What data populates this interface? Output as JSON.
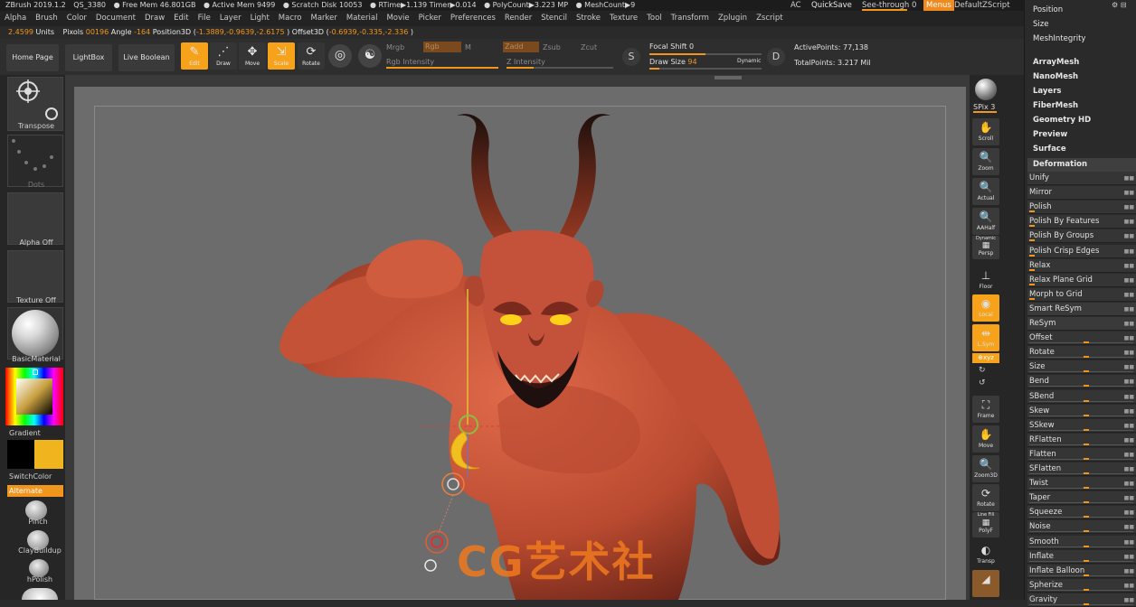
{
  "titlebar": {
    "app": "ZBrush 2019.1.2",
    "doc": "QS_3380",
    "free_mem": "● Free Mem 46.801GB",
    "active_mem": "● Active Mem 9499",
    "scratch": "● Scratch Disk 10053",
    "rtime": "● RTime▶1.139 Timer▶0.014",
    "polycount": "● PolyCount▶3.223 MP",
    "meshcount": "● MeshCount▶9"
  },
  "menubar": {
    "items": [
      "Alpha",
      "Brush",
      "Color",
      "Document",
      "Draw",
      "Edit",
      "File",
      "Layer",
      "Light",
      "Macro",
      "Marker",
      "Material",
      "Movie",
      "Picker",
      "Preferences",
      "Render",
      "Stencil",
      "Stroke",
      "Texture",
      "Tool",
      "Transform",
      "Zplugin",
      "Zscript"
    ]
  },
  "topright": {
    "ac": "AC",
    "quicksave": "QuickSave",
    "seethrough": "See-through",
    "seethrough_value": "0",
    "menus": "Menus",
    "defaultzscript": "DefaultZScript"
  },
  "status": {
    "units_value": "2.4599",
    "units_label": "Units",
    "pixols_label": "Pixols",
    "pixols_value": "00196",
    "angle_label": "Angle",
    "angle_value": "-164",
    "pos3d_label": "Position3D (",
    "pos3d_value": "-1.3889,-0.9639,-2.6175",
    "pos3d_close": ")",
    "off3d_label": "Offset3D (",
    "off3d_value": "-0.6939,-0.335,-2.336",
    "off3d_close": ")"
  },
  "shelf": {
    "homepage": "Home Page",
    "lightbox": "LightBox",
    "liveboolean": "Live Boolean",
    "edit": "Edit",
    "draw": "Draw",
    "move": "Move",
    "scale": "Scale",
    "rotate": "Rotate",
    "mrgb": "Mrgb",
    "rgb": "Rgb",
    "m": "M",
    "rgb_intensity": "Rgb Intensity",
    "zadd": "Zadd",
    "zsub": "Zsub",
    "zcut": "Zcut",
    "z_intensity": "Z Intensity",
    "focal_shift_label": "Focal Shift",
    "focal_shift_value": "0",
    "draw_size_label": "Draw Size",
    "draw_size_value": "94",
    "dynamic": "Dynamic",
    "active_points_label": "ActivePoints:",
    "active_points_value": "77,138",
    "total_points_label": "TotalPoints:",
    "total_points_value": "3.217 Mil",
    "draw_size_fraction": 0.09,
    "focal_shift_fraction": 0.5,
    "rgb_intensity_fraction": 1.0,
    "z_intensity_fraction": 0.25
  },
  "lefttray": {
    "transpose": "Transpose",
    "dots": "Dots",
    "alpha": "Alpha Off",
    "texture": "Texture Off",
    "material": "BasicMaterial",
    "gradient": "Gradient",
    "switchcolor": "SwitchColor",
    "alternate": "Alternate",
    "brushes": [
      "Pinch",
      "ClayBuildup",
      "hPolish"
    ],
    "main_color": "#f0b41e",
    "secondary_color": "#000000"
  },
  "rightcol": {
    "bpr": "BPR",
    "spix_label": "SPix",
    "spix_value": "3",
    "scroll": "Scroll",
    "zoom": "Zoom",
    "actual": "Actual",
    "aahalf": "AAHalf",
    "dynamic": "Dynamic",
    "persp": "Persp",
    "floor": "Floor",
    "local": "Local",
    "lsym": "L.Sym",
    "xyz": "xyz",
    "frame": "Frame",
    "move": "Move",
    "zoom3d": "Zoom3D",
    "rotate": "Rotate",
    "linefill": "Line Fill",
    "polyf": "PolyF",
    "transp": "Transp"
  },
  "rightpanel": {
    "top_items": [
      "Position",
      "Size",
      "MeshIntegrity"
    ],
    "sub_items": [
      "ArrayMesh",
      "NanoMesh",
      "Layers",
      "FiberMesh",
      "Geometry HD",
      "Preview",
      "Surface",
      "Deformation"
    ],
    "rows": [
      "Unify",
      "Mirror",
      "Polish",
      "Polish By Features",
      "Polish By Groups",
      "Polish Crisp Edges",
      "Relax",
      "Relax Plane Grid",
      "Morph to Grid",
      "Smart ReSym",
      "ReSym",
      "Offset",
      "Rotate",
      "Size",
      "Bend",
      "SBend",
      "Skew",
      "SSkew",
      "RFlatten",
      "Flatten",
      "SFlatten",
      "Twist",
      "Taper",
      "Squeeze",
      "Noise",
      "Smooth",
      "Inflate",
      "Inflate Balloon",
      "Spherize",
      "Gravity"
    ]
  },
  "watermark": "CG艺术社",
  "colors": {
    "accent": "#f0961e",
    "canvas": "#6c6c6c",
    "skin": "#c8553a",
    "horn": "#3a1c16",
    "eye": "#ffd21a"
  }
}
